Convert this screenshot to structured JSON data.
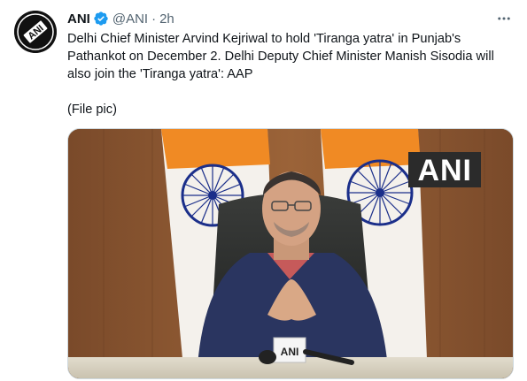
{
  "tweet": {
    "avatar_text": "ANI",
    "name": "ANI",
    "handle": "@ANI",
    "separator": "·",
    "time": "2h",
    "text": "Delhi Chief Minister Arvind Kejriwal to hold 'Tiranga yatra' in Punjab's Pathankot on December 2. Delhi Deputy Chief Minister Manish Sisodia will also join the 'Tiranga yatra': AAP\n\n(File pic)",
    "more_icon": "more-options-icon",
    "verified_icon": "verified-badge-icon"
  },
  "media": {
    "watermark": "ANI",
    "mic_text": "ANI"
  }
}
